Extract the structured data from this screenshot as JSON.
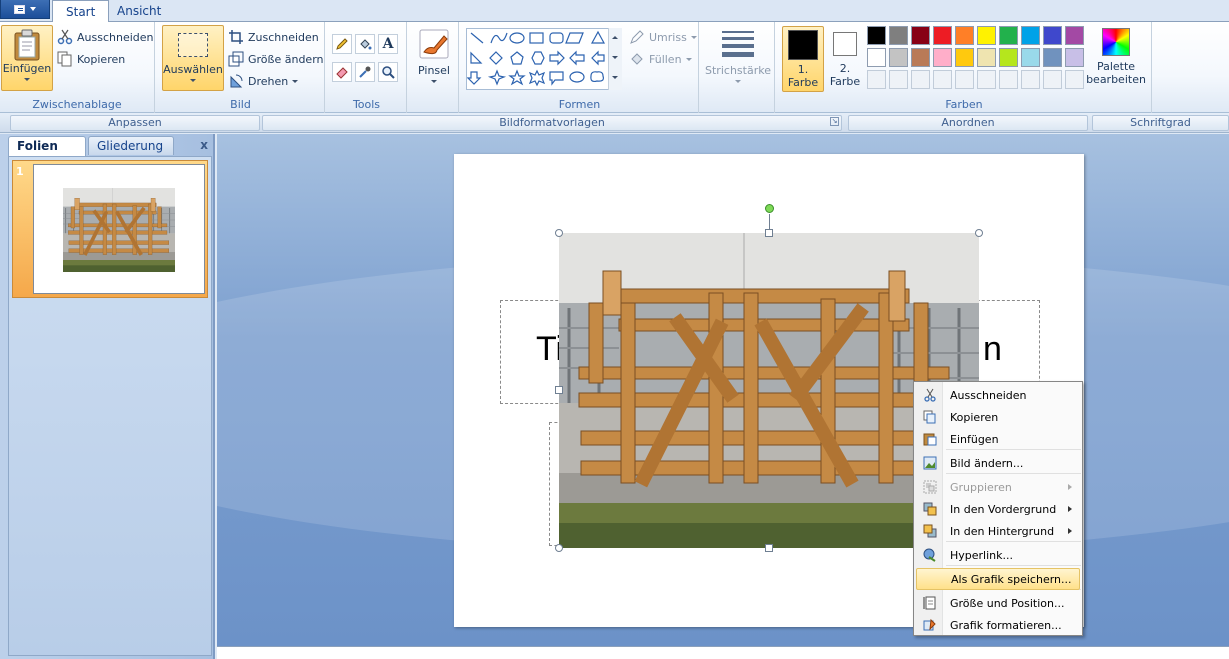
{
  "tabs": {
    "start": "Start",
    "view": "Ansicht"
  },
  "ribbon": {
    "clipboard": {
      "paste": "Einfügen",
      "cut": "Ausschneiden",
      "copy": "Kopieren",
      "label": "Zwischenablage"
    },
    "image": {
      "select": "Auswählen",
      "crop": "Zuschneiden",
      "resize": "Größe ändern",
      "rotate": "Drehen",
      "label": "Bild"
    },
    "tools": {
      "label": "Tools",
      "icons": [
        "pencil-icon",
        "fill-bucket-icon",
        "text-icon",
        "eraser-icon",
        "color-picker-icon",
        "magnifier-icon"
      ]
    },
    "brush": {
      "label": "Pinsel"
    },
    "shapes": {
      "outline": "Umriss",
      "fill": "Füllen",
      "label": "Formen"
    },
    "stroke": {
      "label": "Strichstärke"
    },
    "colors": {
      "color1": "1. Farbe",
      "color2": "2. Farbe",
      "edit": "Palette bearbeiten",
      "label": "Farben",
      "color1_value": "#000000",
      "color2_value": "#ffffff",
      "palette_row1": [
        "#000000",
        "#7f7f7f",
        "#880015",
        "#ed1c24",
        "#ff7f27",
        "#fff200",
        "#22b14c",
        "#00a2e8",
        "#3f48cc",
        "#a349a4"
      ],
      "palette_row2": [
        "#ffffff",
        "#c3c3c3",
        "#b97a57",
        "#ffaec9",
        "#ffc90e",
        "#efe4b0",
        "#b5e61d",
        "#99d9ea",
        "#7092be",
        "#c8bfe7"
      ]
    }
  },
  "subbar": {
    "adjust": "Anpassen",
    "styles": "Bildformatvorlagen",
    "arrange": "Anordnen",
    "fontsize": "Schriftgrad"
  },
  "left_panel": {
    "tab_slides": "Folien",
    "tab_outline": "Gliederung",
    "close": "x",
    "slide_number": "1"
  },
  "slide": {
    "title_left": "Ti",
    "title_right": "n"
  },
  "context_menu": {
    "items": [
      {
        "label": "Ausschneiden",
        "icon": "scissors-icon",
        "disabled": false
      },
      {
        "label": "Kopieren",
        "icon": "copy-icon",
        "disabled": false
      },
      {
        "label": "Einfügen",
        "icon": "paste-icon",
        "disabled": false
      },
      {
        "label": "Bild ändern...",
        "icon": "change-picture-icon",
        "disabled": false
      },
      {
        "label": "Gruppieren",
        "icon": "group-icon",
        "disabled": true
      },
      {
        "label": "In den Vordergrund",
        "icon": "bring-front-icon",
        "disabled": false
      },
      {
        "label": "In den Hintergrund",
        "icon": "send-back-icon",
        "disabled": false
      },
      {
        "label": "Hyperlink...",
        "icon": "hyperlink-icon",
        "disabled": false
      },
      {
        "label": "Als Grafik speichern...",
        "icon": "",
        "disabled": false,
        "highlighted": true
      },
      {
        "label": "Größe und Position...",
        "icon": "size-position-icon",
        "disabled": false
      },
      {
        "label": "Grafik formatieren...",
        "icon": "format-picture-icon",
        "disabled": false
      }
    ]
  }
}
